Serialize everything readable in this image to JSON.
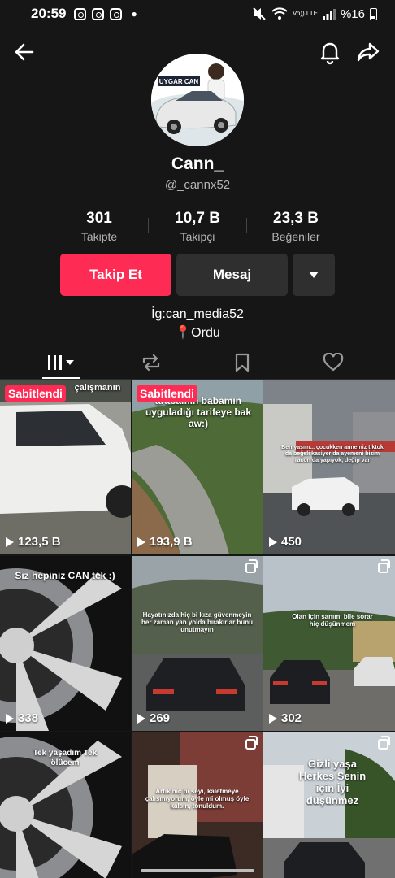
{
  "status_bar": {
    "time": "20:59",
    "net": "Vo)) LTE",
    "battery": "%16"
  },
  "nav": {
    "back_icon": "arrow-left-icon",
    "bell_icon": "bell-icon",
    "share_icon": "share-icon"
  },
  "profile": {
    "avatar_text": "UYGAR CAN",
    "name": "Cann_",
    "handle": "@_cannx52",
    "stats": [
      {
        "value": "301",
        "label": "Takipte"
      },
      {
        "value": "10,7 B",
        "label": "Takipçi"
      },
      {
        "value": "23,3 B",
        "label": "Beğeniler"
      }
    ],
    "follow_label": "Takip Et",
    "message_label": "Mesaj",
    "bio_line1": "İg:can_media52",
    "bio_line2": "📍Ordu"
  },
  "tabs": [
    "videos-tab",
    "reposts-tab",
    "favorites-tab",
    "liked-tab"
  ],
  "videos": [
    {
      "pinned": "Sabitlendi",
      "views": "123,5 B",
      "caption": "çalışmanın",
      "multi": false
    },
    {
      "pinned": "Sabitlendi",
      "views": "193,9 B",
      "caption": "arabamın babamın uyguladığı tarifeye bak aw:)",
      "multi": false
    },
    {
      "pinned": "",
      "views": "450",
      "caption": "Ben yaşım... çocukken annemiz tiktok da beğeli kasiyer da ayemeni bizim racon da yapıyok, değip var",
      "multi": false
    },
    {
      "pinned": "",
      "views": "338",
      "caption": "Siz hepiniz CAN tek :)",
      "multi": false
    },
    {
      "pinned": "",
      "views": "269",
      "caption": "Hayatınızda hiç bi kıza güvenmeyin her zaman yan yolda bırakırlar bunu unutmayın",
      "multi": true
    },
    {
      "pinned": "",
      "views": "302",
      "caption": "Olan için sanımı bile sorar hiç düşünmem",
      "multi": true
    },
    {
      "pinned": "",
      "views": "",
      "caption": "Tek yaşadım Tek ölücem",
      "multi": false
    },
    {
      "pinned": "",
      "views": "",
      "caption": "Artık hiç bi şeyi, kaletmeye çalışmıyorum, öyle mi olmuş öyle kalsın, tonuldum.",
      "multi": true
    },
    {
      "pinned": "",
      "views": "",
      "caption": "Gizli yaşa Herkes Senin için İyi düşünmez",
      "multi": true
    }
  ]
}
